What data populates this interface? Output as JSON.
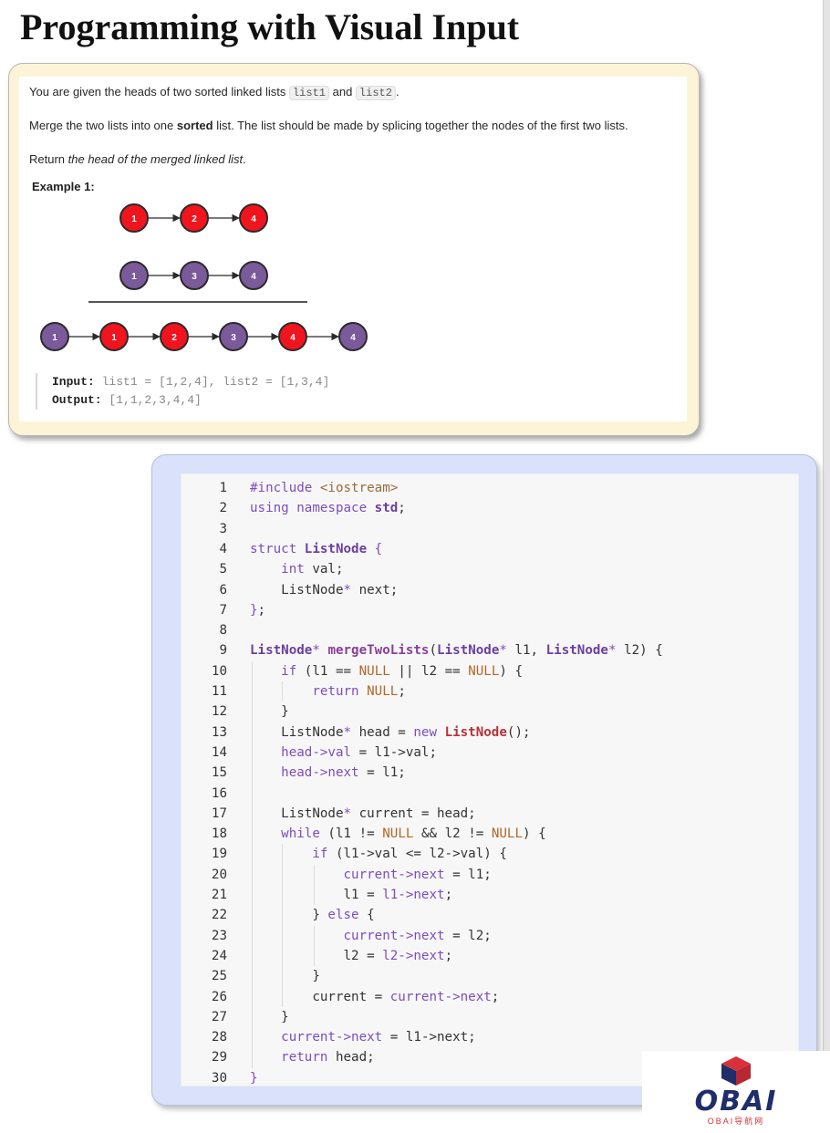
{
  "title": "Programming with Visual Input",
  "problem": {
    "p1_before": "You are given the heads of two sorted linked lists ",
    "list1_code": "list1",
    "p1_mid": " and ",
    "list2_code": "list2",
    "p1_end": ".",
    "p2_before": "Merge the two lists into one ",
    "p2_bold": "sorted",
    "p2_after": " list. The list should be made by splicing together the nodes of the first two lists.",
    "p3_before": "Return ",
    "p3_italic": "the head of the merged linked list",
    "p3_after": ".",
    "example_label": "Example 1:",
    "diagram": {
      "list1": [
        "1",
        "2",
        "4"
      ],
      "list2": [
        "1",
        "3",
        "4"
      ],
      "merged": [
        "1",
        "1",
        "2",
        "3",
        "4",
        "4"
      ],
      "merged_sources": [
        "list2",
        "list1",
        "list1",
        "list2",
        "list1",
        "list2"
      ],
      "colors": {
        "list1": "#f0141e",
        "list2": "#7a5a9a",
        "stroke": "#2b2b2b"
      }
    },
    "input_label": "Input:",
    "input_value": "list1 = [1,2,4], list2 = [1,3,4]",
    "output_label": "Output:",
    "output_value": "[1,1,2,3,4,4]"
  },
  "code": {
    "lines": [
      [
        [
          "#include ",
          "kw"
        ],
        [
          "<iostream>",
          "str"
        ]
      ],
      [
        [
          "using namespace ",
          "kw"
        ],
        [
          "std",
          "ty"
        ],
        [
          ";",
          ""
        ]
      ],
      [],
      [
        [
          "struct ",
          "kw"
        ],
        [
          "ListNode",
          "ty"
        ],
        [
          " {",
          "pun"
        ]
      ],
      [
        [
          "    ",
          ""
        ],
        [
          "int",
          "kw"
        ],
        [
          " val;",
          ""
        ]
      ],
      [
        [
          "    ListNode",
          ""
        ],
        [
          "*",
          "pun"
        ],
        [
          " next;",
          ""
        ]
      ],
      [
        [
          "}",
          "pun"
        ],
        [
          ";",
          ""
        ]
      ],
      [],
      [
        [
          "ListNode",
          "ty"
        ],
        [
          "* ",
          "pun"
        ],
        [
          "mergeTwoLists",
          "fn"
        ],
        [
          "(",
          ""
        ],
        [
          "ListNode",
          "ty"
        ],
        [
          "* ",
          "pun"
        ],
        [
          "l1, ",
          ""
        ],
        [
          "ListNode",
          "ty"
        ],
        [
          "* ",
          "pun"
        ],
        [
          "l2) {",
          ""
        ]
      ],
      [
        [
          "    ",
          ""
        ],
        [
          "if",
          "kw"
        ],
        [
          " (l1 == ",
          ""
        ],
        [
          "NULL",
          "mac"
        ],
        [
          " || l2 == ",
          ""
        ],
        [
          "NULL",
          "mac"
        ],
        [
          ") {",
          ""
        ]
      ],
      [
        [
          "        ",
          ""
        ],
        [
          "return",
          "kw"
        ],
        [
          " ",
          ""
        ],
        [
          "NULL",
          "mac"
        ],
        [
          ";",
          ""
        ]
      ],
      [
        [
          "    }",
          ""
        ]
      ],
      [
        [
          "    ListNode",
          ""
        ],
        [
          "*",
          "pun"
        ],
        [
          " head = ",
          ""
        ],
        [
          "new",
          "kw"
        ],
        [
          " ",
          ""
        ],
        [
          "ListNode",
          "ctor"
        ],
        [
          "();",
          ""
        ]
      ],
      [
        [
          "    ",
          ""
        ],
        [
          "head->val",
          "kw"
        ],
        [
          " = l1->val;",
          ""
        ]
      ],
      [
        [
          "    ",
          ""
        ],
        [
          "head->next",
          "kw"
        ],
        [
          " = l1;",
          ""
        ]
      ],
      [],
      [
        [
          "    ListNode",
          ""
        ],
        [
          "*",
          "pun"
        ],
        [
          " current = head;",
          ""
        ]
      ],
      [
        [
          "    ",
          ""
        ],
        [
          "while",
          "kw"
        ],
        [
          " (l1 != ",
          ""
        ],
        [
          "NULL",
          "mac"
        ],
        [
          " && l2 != ",
          ""
        ],
        [
          "NULL",
          "mac"
        ],
        [
          ") {",
          ""
        ]
      ],
      [
        [
          "        ",
          ""
        ],
        [
          "if",
          "kw"
        ],
        [
          " (l1->val <= l2->val) {",
          ""
        ]
      ],
      [
        [
          "            ",
          ""
        ],
        [
          "current->next",
          "kw"
        ],
        [
          " = l1;",
          ""
        ]
      ],
      [
        [
          "            l1 = ",
          ""
        ],
        [
          "l1->next",
          "kw"
        ],
        [
          ";",
          ""
        ]
      ],
      [
        [
          "        } ",
          ""
        ],
        [
          "else",
          "kw"
        ],
        [
          " {",
          ""
        ]
      ],
      [
        [
          "            ",
          ""
        ],
        [
          "current->next",
          "kw"
        ],
        [
          " = l2;",
          ""
        ]
      ],
      [
        [
          "            l2 = ",
          ""
        ],
        [
          "l2->next",
          "kw"
        ],
        [
          ";",
          ""
        ]
      ],
      [
        [
          "        }",
          ""
        ]
      ],
      [
        [
          "        current = ",
          ""
        ],
        [
          "current->next",
          "kw"
        ],
        [
          ";",
          ""
        ]
      ],
      [
        [
          "    }",
          ""
        ]
      ],
      [
        [
          "    ",
          ""
        ],
        [
          "current->next",
          "kw"
        ],
        [
          " = l1->next;",
          ""
        ]
      ],
      [
        [
          "    ",
          ""
        ],
        [
          "return",
          "kw"
        ],
        [
          " head;",
          ""
        ]
      ],
      [
        [
          "}",
          "pun"
        ]
      ]
    ]
  },
  "watermark": {
    "text": "OBAI",
    "sub": "OBAI导航网",
    "colors": {
      "navy": "#1f2d6b",
      "red": "#d7323a"
    }
  }
}
